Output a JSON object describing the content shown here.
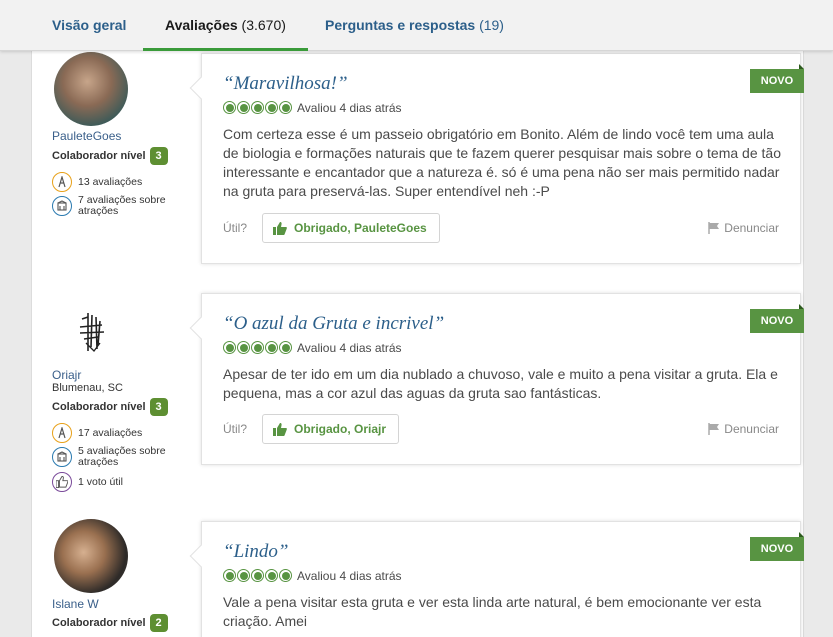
{
  "tabs": [
    {
      "label": "Visão geral",
      "count": ""
    },
    {
      "label": "Avaliações",
      "count": "(3.670)"
    },
    {
      "label": "Perguntas e respostas",
      "count": "(19)"
    }
  ],
  "common": {
    "level_label": "Colaborador nível",
    "util_label": "Útil?",
    "report_label": "Denunciar",
    "new_label": "NOVO",
    "rating": 5,
    "rating_max": 5
  },
  "reviews": [
    {
      "user": {
        "name": "PauleteGoes",
        "location": "",
        "level": "3",
        "stats": [
          "13 avaliações",
          "7 avaliações sobre atrações"
        ]
      },
      "title": "“Maravilhosa!”",
      "date": "Avaliou 4 dias atrás",
      "text": "Com certeza esse é um passeio obrigatório em Bonito. Além de lindo você tem uma aula de biologia e formações naturais que te fazem querer pesquisar mais sobre o tema de tão interessante e encantador que a natureza é. só é uma pena não ser mais permitido nadar na gruta para preservá-las. Super entendível neh :-P",
      "thanks": "Obrigado, PauleteGoes"
    },
    {
      "user": {
        "name": "Oriajr",
        "location": "Blumenau, SC",
        "level": "3",
        "stats": [
          "17 avaliações",
          "5 avaliações sobre atrações",
          "1 voto útil"
        ]
      },
      "title": "“O azul da Gruta e incrivel”",
      "date": "Avaliou 4 dias atrás",
      "text": "Apesar de ter ido em um dia nublado a chuvoso, vale e muito a pena visitar a gruta. Ela e pequena, mas a cor azul das aguas da gruta sao fantásticas.",
      "thanks": "Obrigado, Oriajr"
    },
    {
      "user": {
        "name": "Islane W",
        "location": "",
        "level": "2",
        "stats": []
      },
      "title": "“Lindo”",
      "date": "Avaliou 4 dias atrás",
      "text": "Vale a pena visitar esta gruta e ver esta linda arte natural, é bem emocionante ver esta criação. Amei",
      "thanks": ""
    }
  ]
}
